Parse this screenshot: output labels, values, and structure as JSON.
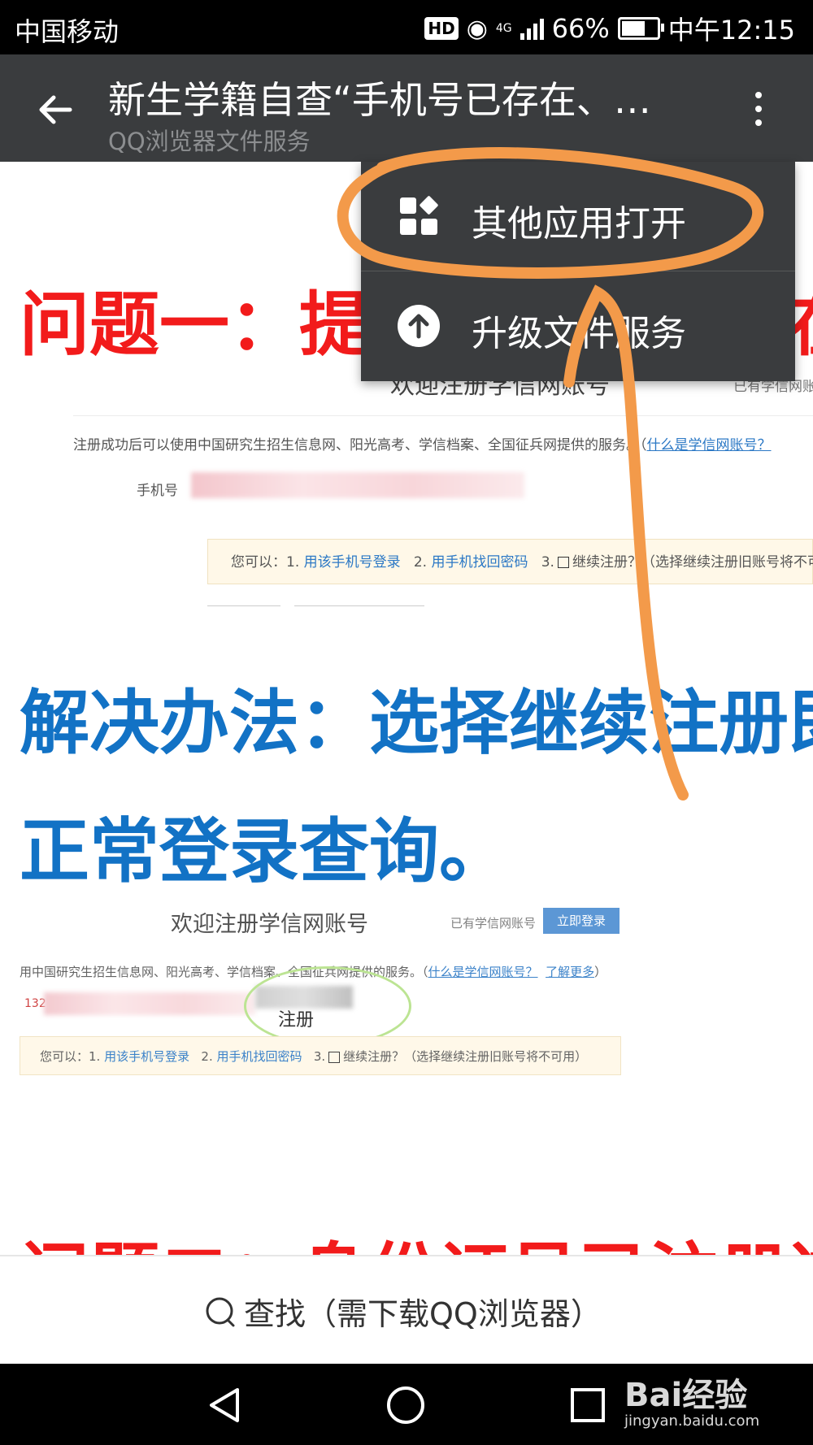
{
  "status_bar": {
    "carrier": "中国移动",
    "hd": "HD",
    "network": "4G",
    "battery": "66%",
    "battery_level": 0.66,
    "time": "中午12:15"
  },
  "app_bar": {
    "title": "新生学籍自查“手机号已存在、…",
    "subtitle": "QQ浏览器文件服务"
  },
  "menu": {
    "items": [
      {
        "label": "其他应用打开",
        "icon": "apps-icon"
      },
      {
        "label": "升级文件服务",
        "icon": "upload-icon"
      }
    ]
  },
  "content": {
    "heading1": "问题一：提示手机号已存在！",
    "shot1": {
      "title": "欢迎注册学信网账号",
      "login_hint": "已有学信网账号",
      "desc": "注册成功后可以使用中国研究生招生信息网、阳光高考、学信档案、全国征兵网提供的服务。（",
      "desc_link": "什么是学信网账号？",
      "phone_label": "手机号",
      "tip_prefix": "您可以：1.",
      "tip_link1": "用该手机号登录",
      "tip_mid": "2.",
      "tip_link2": "用手机找回密码",
      "tip_suffix": "3.",
      "tip_end": "继续注册？（选择继续注册旧账号将不可用）"
    },
    "solution_line1": "解决办法：选择继续注册即可",
    "solution_line2": "正常登录查询。",
    "shot2": {
      "title": "欢迎注册学信网账号",
      "login_hint": "已有学信网账号",
      "login_button": "立即登录",
      "desc": "用中国研究生招生信息网、阳光高考、学信档案、全国征兵网提供的服务。（",
      "desc_link1": "什么是学信网账号？",
      "desc_link2": "了解更多",
      "desc_end": "）",
      "phone_prefix": "132",
      "bubble_text": "注册",
      "tip_prefix": "您可以：1.",
      "tip_link1": "用该手机号登录",
      "tip_mid": "2.",
      "tip_link2": "用手机找回密码",
      "tip_suffix": "3.",
      "tip_end": "继续注册？（选择继续注册旧账号将不可用）"
    },
    "heading2": "问题二：身份证号已注册过！"
  },
  "find_bar": {
    "label": "查找（需下载QQ浏览器）"
  },
  "watermark": {
    "brand": "Bai经验",
    "url": "jingyan.baidu.com"
  },
  "colors": {
    "red_heading": "#f21b1b",
    "blue_heading": "#1272c5",
    "annotation": "#f39a4a",
    "menu_bg": "#3a3c3e"
  }
}
